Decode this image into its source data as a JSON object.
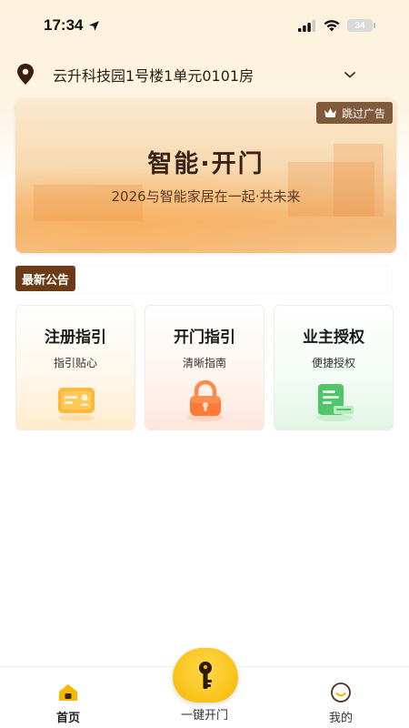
{
  "status_bar": {
    "time": "17:34",
    "battery": "34"
  },
  "address": {
    "text": "云升科技园1号楼1单元0101房"
  },
  "banner": {
    "skip_label": "跳过广告",
    "title": "智能·开门",
    "subtitle": "2026与智能家居在一起·共未来"
  },
  "notice": {
    "label": "最新公告"
  },
  "cards": [
    {
      "title": "注册指引",
      "subtitle": "指引贴心"
    },
    {
      "title": "开门指引",
      "subtitle": "清晰指南"
    },
    {
      "title": "业主授权",
      "subtitle": "便捷授权"
    }
  ],
  "tab_bar": {
    "home": "首页",
    "center": "一键开门",
    "mine": "我的"
  },
  "colors": {
    "accent": "#f6b800",
    "brand_brown": "#6b3a16"
  }
}
